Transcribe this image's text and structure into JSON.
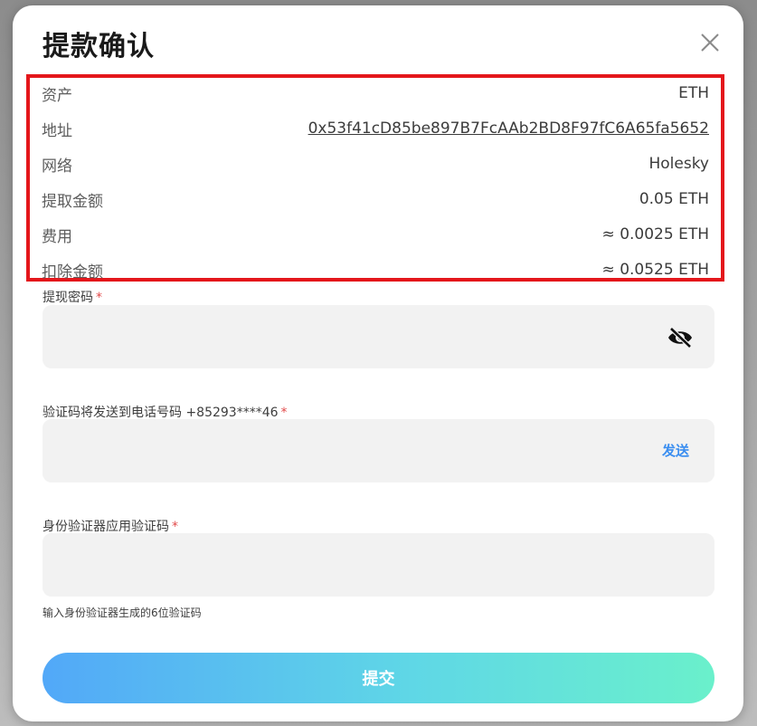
{
  "dialog": {
    "title": "提款确认",
    "close_icon": "close-icon"
  },
  "summary": {
    "border_color": "#e4161b",
    "rows": [
      {
        "label": "资产",
        "value": "ETH"
      },
      {
        "label": "地址",
        "value": "0x53f41cD85be897B7FcAAb2BD8F97fC6A65fa5652"
      },
      {
        "label": "网络",
        "value": "Holesky"
      },
      {
        "label": "提取金额",
        "value": "0.05 ETH"
      },
      {
        "label": "费用",
        "value": "≈ 0.0025 ETH"
      },
      {
        "label": "扣除金额",
        "value": "≈ 0.0525 ETH"
      }
    ]
  },
  "form": {
    "required_mark": "*",
    "password": {
      "label": "提现密码",
      "value": "",
      "toggle_icon": "eye-slash-icon"
    },
    "sms_code": {
      "label": "验证码将发送到电话号码 +85293****46",
      "value": "",
      "send_label": "发送"
    },
    "authenticator": {
      "label": "身份验证器应用验证码",
      "value": "",
      "hint": "输入身份验证器生成的6位验证码"
    },
    "submit_label": "提交"
  },
  "colors": {
    "required": "#e24a4a",
    "send_link": "#3b8ef0",
    "submit_gradient": [
      "#52a8f8",
      "#6af0cb"
    ]
  }
}
